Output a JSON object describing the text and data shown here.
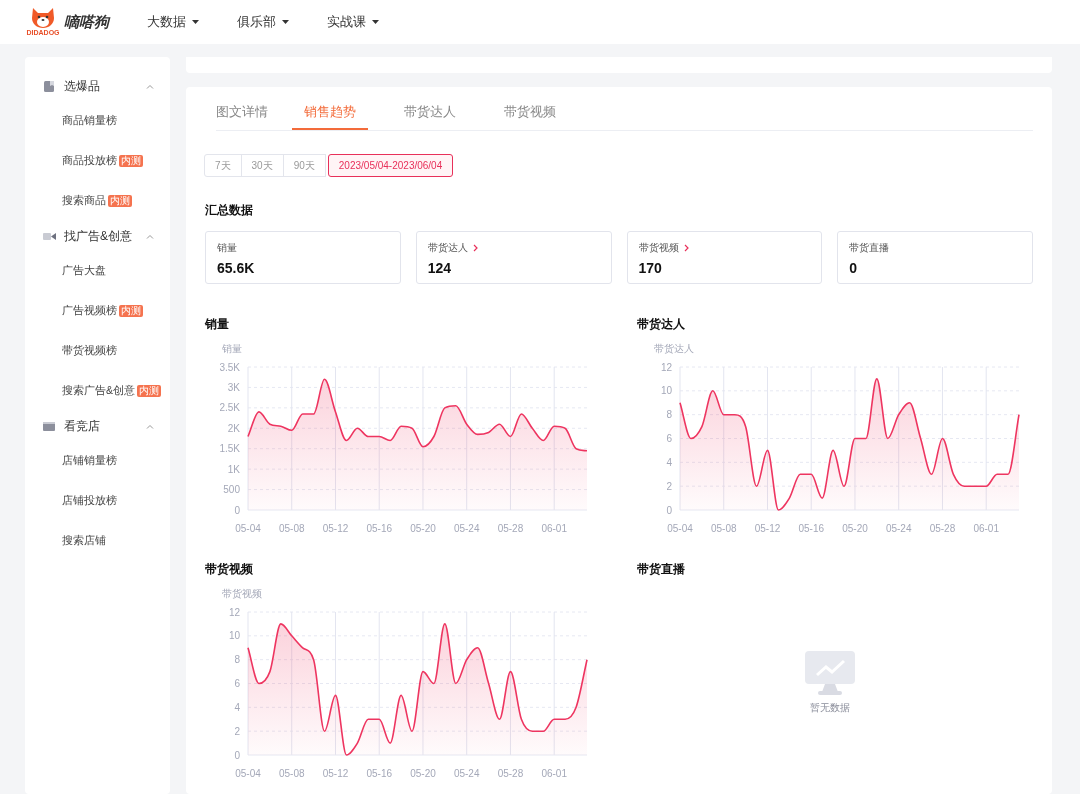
{
  "nav": {
    "logo_caption": "DIDADOG",
    "brand": "嘀嗒狗",
    "menu": [
      {
        "label": "大数据"
      },
      {
        "label": "俱乐部"
      },
      {
        "label": "实战课"
      }
    ]
  },
  "sidebar": {
    "groups": [
      {
        "title": "选爆品",
        "expanded": true,
        "items": [
          {
            "label": "商品销量榜"
          },
          {
            "label": "商品投放榜",
            "badge": "内测"
          },
          {
            "label": "搜索商品",
            "badge": "内测"
          }
        ]
      },
      {
        "title": "找广告&创意",
        "expanded": true,
        "items": [
          {
            "label": "广告大盘"
          },
          {
            "label": "广告视频榜",
            "badge": "内测"
          },
          {
            "label": "带货视频榜"
          },
          {
            "label": "搜索广告&创意",
            "badge": "内测"
          }
        ]
      },
      {
        "title": "看竞店",
        "expanded": true,
        "items": [
          {
            "label": "店铺销量榜"
          },
          {
            "label": "店铺投放榜"
          },
          {
            "label": "搜索店铺"
          }
        ]
      }
    ]
  },
  "tabs": [
    {
      "label": "图文详情",
      "selected": false
    },
    {
      "label": "销售趋势",
      "selected": true
    },
    {
      "label": "带货达人",
      "selected": false
    },
    {
      "label": "带货视频",
      "selected": false
    }
  ],
  "ranges": [
    {
      "label": "7天",
      "selected": false
    },
    {
      "label": "30天",
      "selected": false
    },
    {
      "label": "90天",
      "selected": false
    },
    {
      "label": "2023/05/04-2023/06/04",
      "selected": true
    }
  ],
  "summary": {
    "title": "汇总数据",
    "cards": [
      {
        "label": "销量",
        "value": "65.6K",
        "linked": false
      },
      {
        "label": "带货达人",
        "value": "124",
        "linked": true
      },
      {
        "label": "带货视频",
        "value": "170",
        "linked": true
      },
      {
        "label": "带货直播",
        "value": "0",
        "linked": false
      }
    ]
  },
  "charts": [
    {
      "title": "销量",
      "kind": "chart",
      "chart_data": {
        "type": "area",
        "grid": true,
        "ylabel": "销量",
        "categories": [
          "05-04",
          null,
          null,
          null,
          "05-08",
          null,
          null,
          null,
          "05-12",
          null,
          null,
          null,
          "05-16",
          null,
          null,
          null,
          "05-20",
          null,
          null,
          null,
          "05-24",
          null,
          null,
          null,
          "05-28",
          null,
          null,
          null,
          "06-01",
          null,
          null,
          null
        ],
        "ylim": [
          0,
          3500
        ],
        "yticks": [
          0,
          500,
          {
            "value": 1000,
            "label": "1K"
          },
          {
            "value": 1500,
            "label": "1.5K"
          },
          {
            "value": 2000,
            "label": "2K"
          },
          {
            "value": 2500,
            "label": "2.5K"
          },
          {
            "value": 3000,
            "label": "3K"
          },
          {
            "value": 3500,
            "label": "3.5K"
          }
        ],
        "series": [
          {
            "color": "#ee3560",
            "values": [
              1800,
              2400,
              2100,
              2050,
              1950,
              2350,
              2350,
              3200,
              2400,
              1700,
              2000,
              1800,
              1800,
              1700,
              2050,
              2000,
              1550,
              1800,
              2500,
              2550,
              2100,
              1850,
              1900,
              2100,
              1800,
              2350,
              2000,
              1700,
              2050,
              2000,
              1500,
              1450
            ]
          }
        ]
      }
    },
    {
      "title": "带货达人",
      "kind": "chart",
      "chart_data": {
        "type": "area",
        "grid": true,
        "ylabel": "带货达人",
        "categories": [
          "05-04",
          null,
          null,
          null,
          "05-08",
          null,
          null,
          null,
          "05-12",
          null,
          null,
          null,
          "05-16",
          null,
          null,
          null,
          "05-20",
          null,
          null,
          null,
          "05-24",
          null,
          null,
          null,
          "05-28",
          null,
          null,
          null,
          "06-01",
          null,
          null,
          null
        ],
        "ylim": [
          0,
          12
        ],
        "yticks": [
          0,
          2,
          4,
          6,
          8,
          10,
          12
        ],
        "series": [
          {
            "color": "#ee3560",
            "values": [
              9,
              6,
              7,
              10,
              8,
              8,
              7,
              2,
              5,
              0,
              1,
              3,
              3,
              1,
              5,
              2,
              6,
              6,
              11,
              6,
              8,
              9,
              6,
              3,
              6,
              3,
              2,
              2,
              2,
              3,
              3,
              8
            ]
          }
        ]
      }
    },
    {
      "title": "带货视频",
      "kind": "chart",
      "chart_data": {
        "type": "area",
        "grid": true,
        "ylabel": "带货视频",
        "categories": [
          "05-04",
          null,
          null,
          null,
          "05-08",
          null,
          null,
          null,
          "05-12",
          null,
          null,
          null,
          "05-16",
          null,
          null,
          null,
          "05-20",
          null,
          null,
          null,
          "05-24",
          null,
          null,
          null,
          "05-28",
          null,
          null,
          null,
          "06-01",
          null,
          null,
          null
        ],
        "ylim": [
          0,
          12
        ],
        "yticks": [
          0,
          2,
          4,
          6,
          8,
          10,
          12
        ],
        "series": [
          {
            "color": "#ee3560",
            "values": [
              9,
              6,
              7,
              11,
              10,
              9,
              8,
              2,
              5,
              0,
              1,
              3,
              3,
              1,
              5,
              2,
              7,
              6,
              11,
              6,
              8,
              9,
              6,
              3,
              7,
              3,
              2,
              2,
              3,
              3,
              4,
              8
            ]
          }
        ]
      }
    },
    {
      "title": "带货直播",
      "kind": "empty",
      "message": "暂无数据"
    }
  ]
}
